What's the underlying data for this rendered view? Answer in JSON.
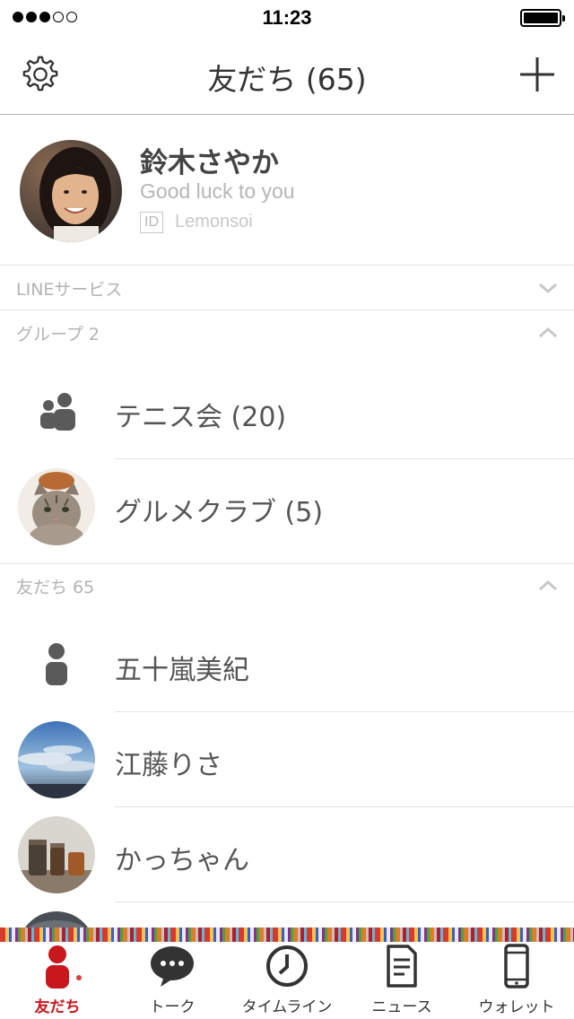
{
  "status_bar": {
    "time": "11:23",
    "signal_total": 5,
    "signal_filled": 3
  },
  "header": {
    "title": "友だち (65)",
    "settings_icon": "gear-icon",
    "add_icon": "plus-icon"
  },
  "profile": {
    "name": "鈴木さやか",
    "status_message": "Good luck to you",
    "id_badge": "ID",
    "id": "Lemonsoi"
  },
  "sections": {
    "line_services": {
      "label": "LINEサービス",
      "state": "collapsed"
    },
    "groups": {
      "label": "グループ 2",
      "state": "expanded",
      "items": [
        {
          "name": "テニス会 (20)",
          "avatar": "group-placeholder-icon"
        },
        {
          "name": "グルメクラブ (5)",
          "avatar": "cat-photo"
        }
      ]
    },
    "friends": {
      "label": "友だち 65",
      "state": "expanded",
      "items": [
        {
          "name": "五十嵐美紀",
          "avatar": "person-placeholder-icon"
        },
        {
          "name": "江藤りさ",
          "avatar": "sky-photo"
        },
        {
          "name": "かっちゃん",
          "avatar": "jars-photo"
        }
      ]
    }
  },
  "tabbar": {
    "active": "friends",
    "tabs": [
      {
        "id": "friends",
        "label": "友だち",
        "icon": "person-icon"
      },
      {
        "id": "talk",
        "label": "トーク",
        "icon": "chat-bubble-icon"
      },
      {
        "id": "timeline",
        "label": "タイムライン",
        "icon": "clock-icon"
      },
      {
        "id": "news",
        "label": "ニュース",
        "icon": "document-icon"
      },
      {
        "id": "wallet",
        "label": "ウォレット",
        "icon": "phone-icon"
      }
    ]
  },
  "colors": {
    "accent": "#c8171d",
    "text": "#333333",
    "muted": "#b3b3b3",
    "divider": "#e2e2e2"
  }
}
